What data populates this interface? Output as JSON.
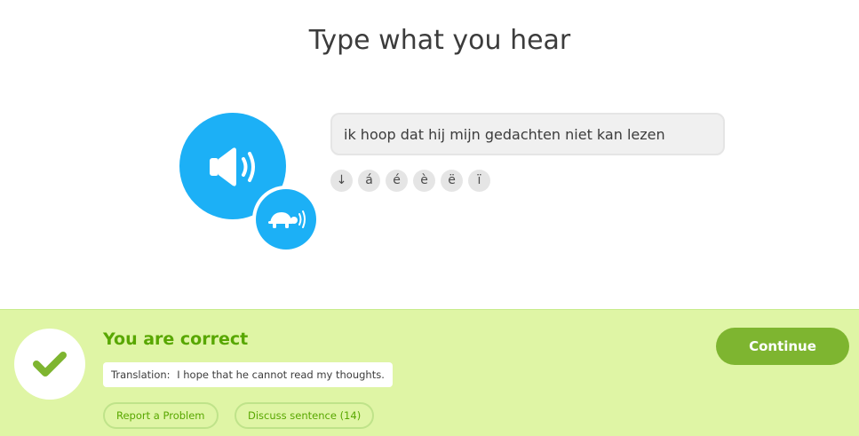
{
  "prompt": {
    "title": "Type what you hear"
  },
  "audio": {
    "play_icon": "speaker-icon",
    "slow_icon": "turtle-icon"
  },
  "answer": {
    "value": "ik hoop dat hij mijn gedachten niet kan lezen"
  },
  "special_chars": [
    "↓",
    "á",
    "é",
    "è",
    "ë",
    "ï"
  ],
  "feedback": {
    "title": "You are correct",
    "translation_label": "Translation:",
    "translation_text": "I hope that he cannot read my thoughts.",
    "report_label": "Report a Problem",
    "discuss_label": "Discuss sentence (14)",
    "continue_label": "Continue",
    "status_icon": "checkmark-icon"
  },
  "colors": {
    "accent_blue": "#1cb0f6",
    "success_bg": "#dff5a5",
    "success_text": "#58a700",
    "continue_bg": "#7eb530"
  }
}
